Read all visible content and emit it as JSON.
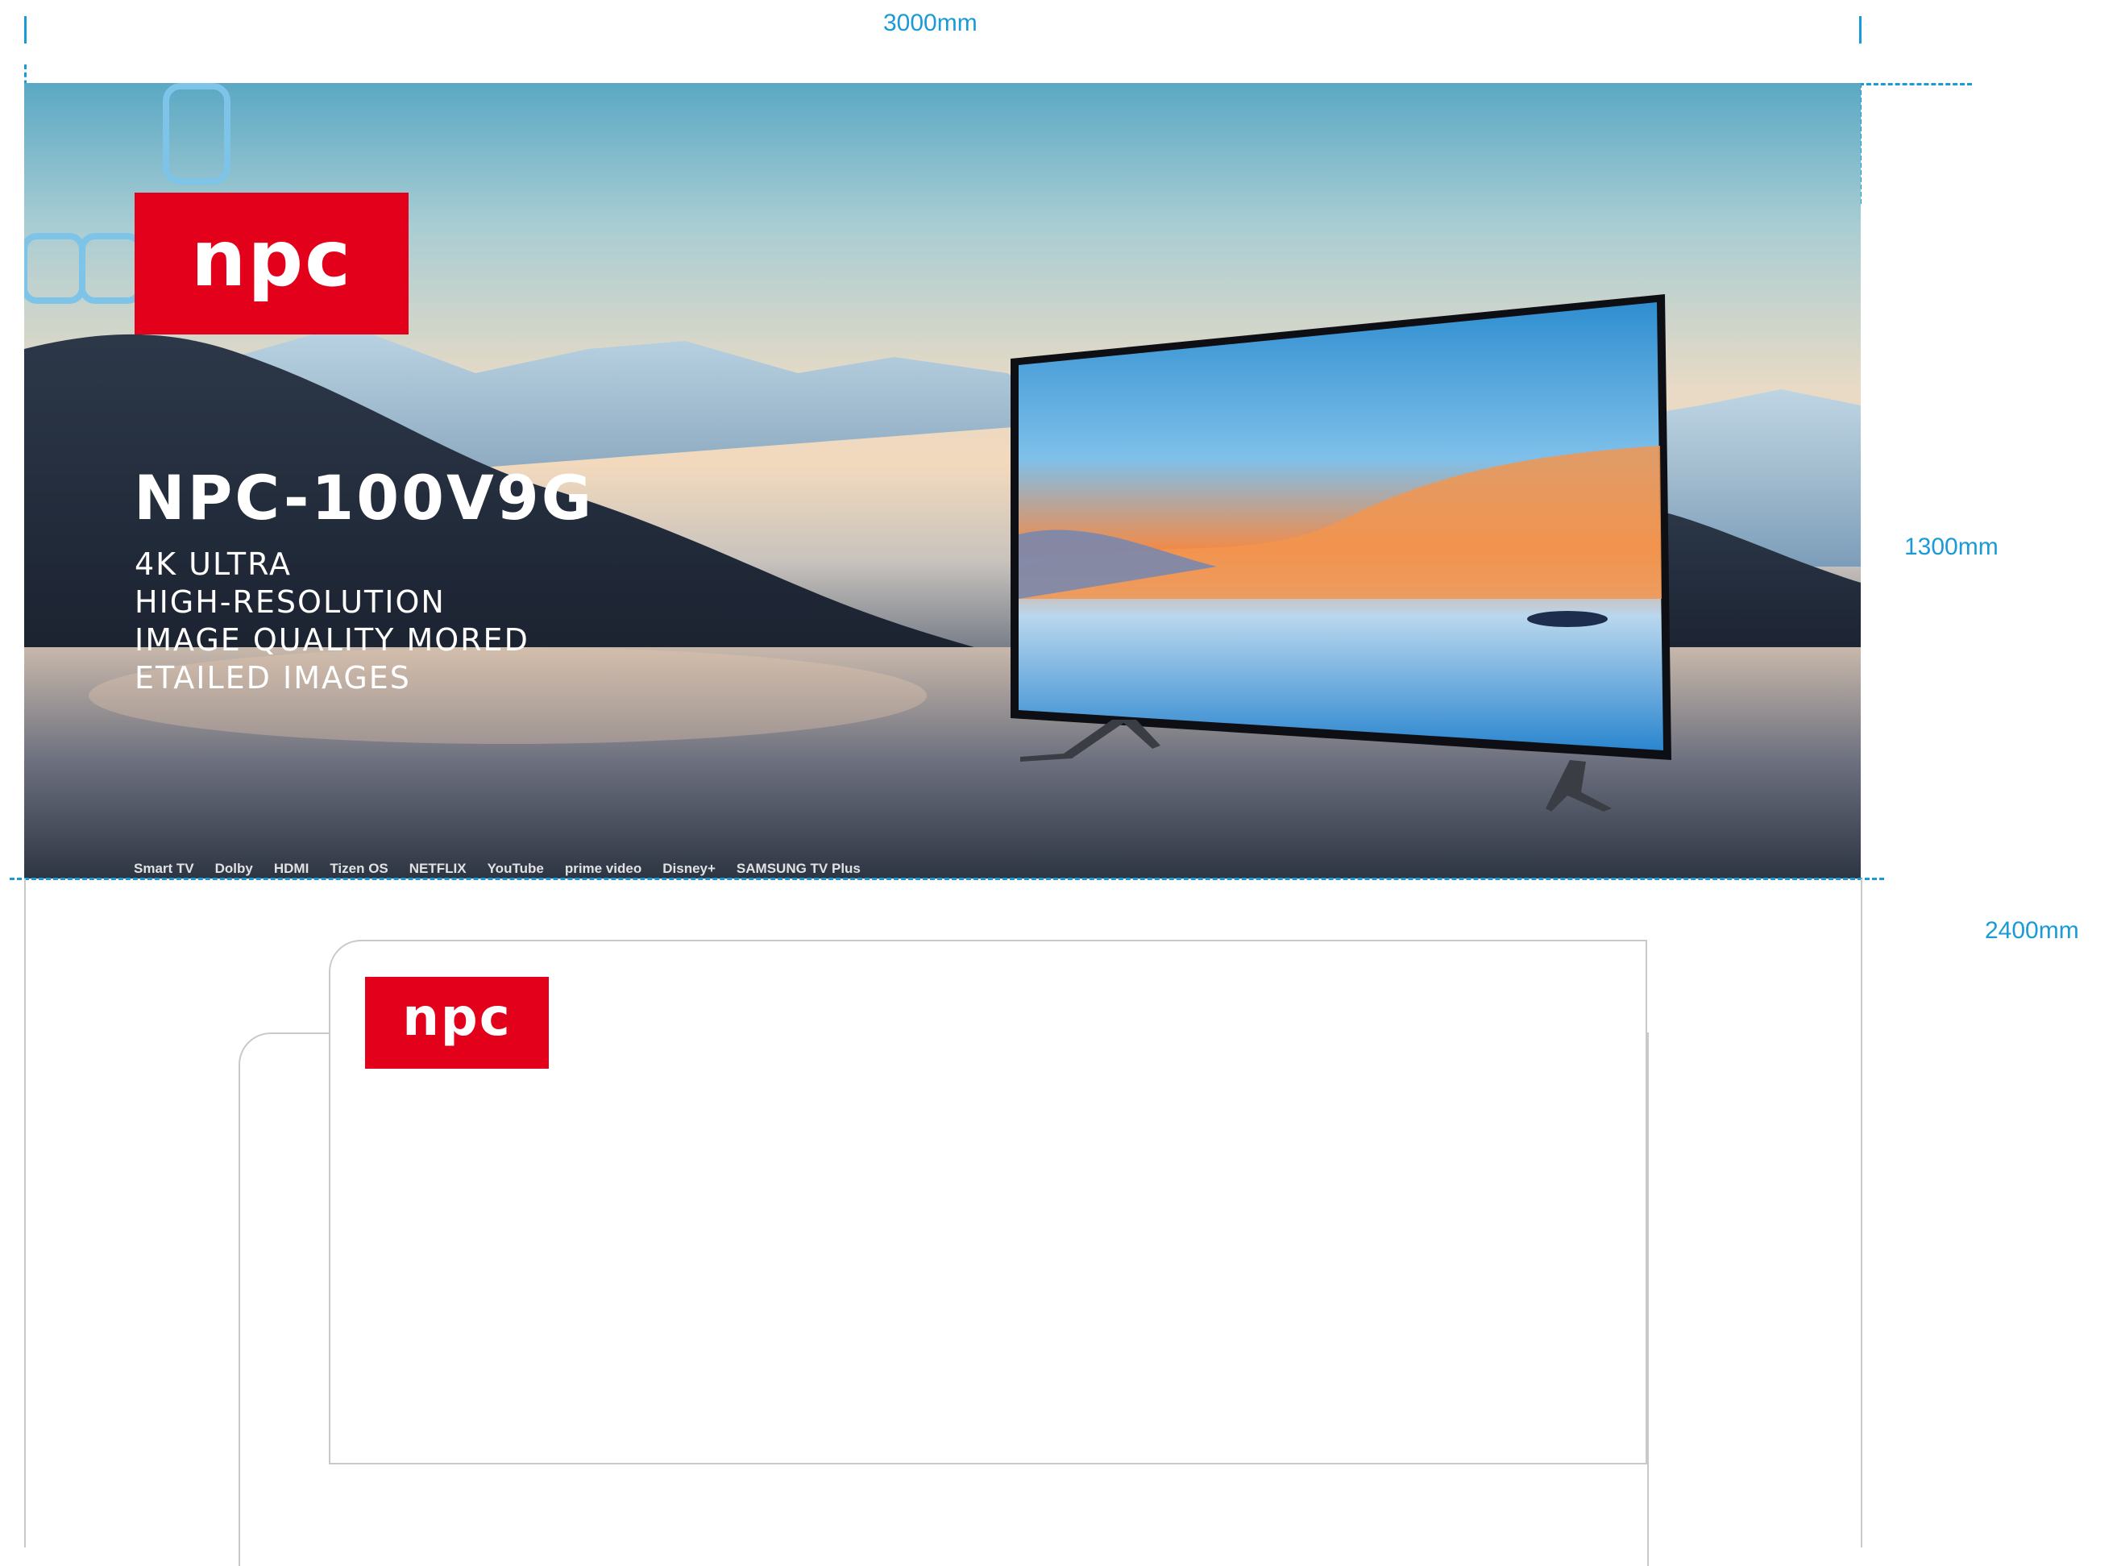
{
  "dimensions": {
    "width_label": "3000mm",
    "banner_height_label": "1300mm",
    "total_height_label": "2400mm"
  },
  "brand": {
    "logo_text": "npc",
    "color": "#e3001b"
  },
  "banner": {
    "model": "NPC-100V9G",
    "tagline": [
      "4K ULTRA",
      "HIGH-RESOLUTION",
      "IMAGE QUALITY MORED",
      "ETAILED IMAGES"
    ],
    "features": [
      "Smart TV",
      "Dolby",
      "HDMI",
      "Tizen OS",
      "NETFLIX",
      "YouTube",
      "prime video",
      "Disney+",
      "SAMSUNG TV Plus"
    ]
  },
  "colors": {
    "dimension_lines": "#1a9ad6",
    "outline": "#c9c9c9"
  }
}
